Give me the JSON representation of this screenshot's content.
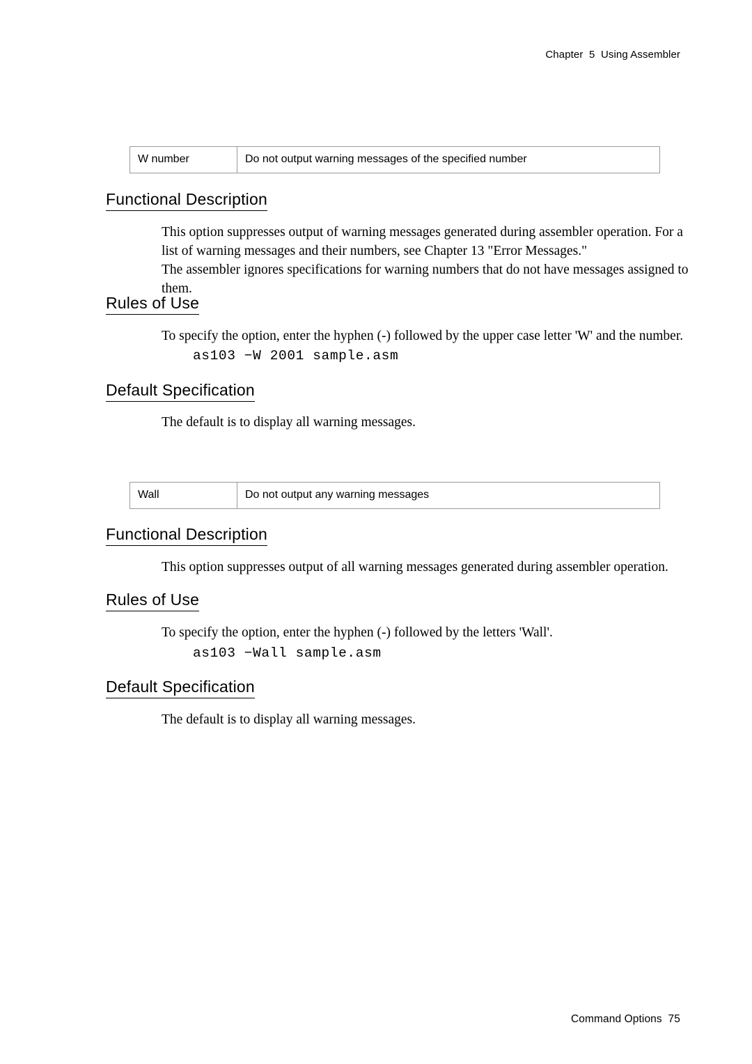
{
  "header": {
    "text": "Chapter  5  Using Assembler"
  },
  "footer": {
    "text": "Command Options  75"
  },
  "tables": [
    {
      "option": "W number",
      "description": "Do not output warning messages of the specified number"
    },
    {
      "option": "Wall",
      "description": "Do not output any warning messages"
    }
  ],
  "sections": [
    {
      "heading": "Functional Description",
      "paragraphs": [
        "This option suppresses output of warning messages generated during assembler operation. For a list of warning messages and their numbers, see Chapter 13 \"Error Messages.\"",
        "The assembler ignores specifications for warning numbers that do not have messages assigned to them."
      ]
    },
    {
      "heading": "Rules of Use",
      "paragraphs": [
        "To specify the option, enter the hyphen (-) followed by the upper case letter 'W' and the number."
      ],
      "code": "as103 −W 2001 sample.asm"
    },
    {
      "heading": "Default Specification",
      "paragraphs": [
        "The default is to display all warning messages."
      ]
    },
    {
      "heading": "Functional Description",
      "paragraphs": [
        "This option suppresses output of all warning messages generated during assembler operation."
      ]
    },
    {
      "heading": "Rules of Use",
      "paragraphs": [
        "To specify the option, enter the hyphen (-) followed by the letters 'Wall'."
      ],
      "code": "as103 −Wall sample.asm"
    },
    {
      "heading": "Default Specification",
      "paragraphs": [
        "The default is to display all warning messages."
      ]
    }
  ]
}
